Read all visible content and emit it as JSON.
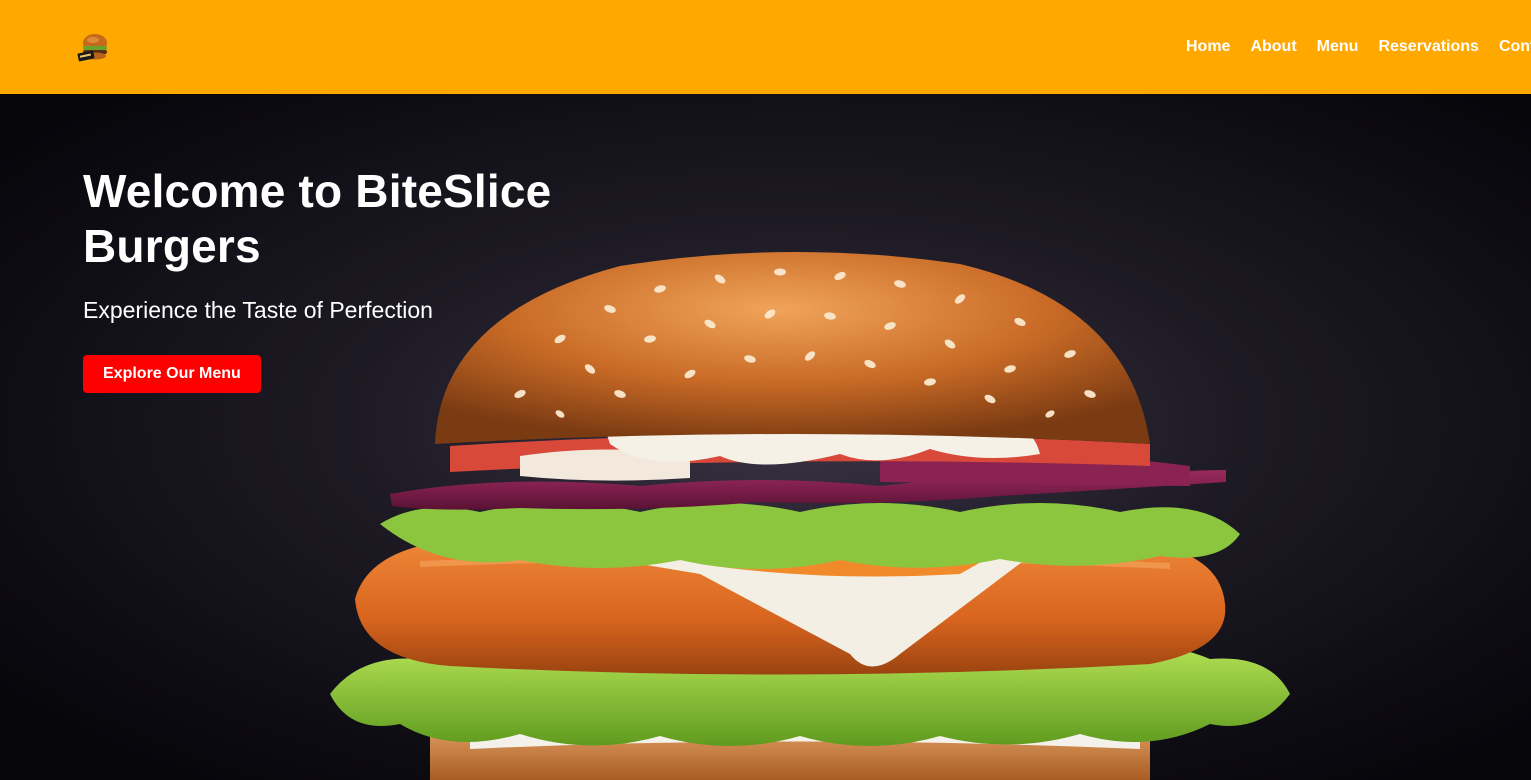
{
  "colors": {
    "header_bg": "#ffa800",
    "hero_bg": "#0d0b12",
    "cta_bg": "#ff0000",
    "text": "#ffffff"
  },
  "header": {
    "logo_icon": "burger-logo-icon",
    "nav": [
      {
        "label": "Home"
      },
      {
        "label": "About"
      },
      {
        "label": "Menu"
      },
      {
        "label": "Reservations"
      },
      {
        "label": "Contact"
      }
    ]
  },
  "hero": {
    "title": "Welcome to BiteSlice Burgers",
    "subtitle": "Experience the Taste of Perfection",
    "cta_label": "Explore Our Menu",
    "image": "burger-photo"
  }
}
